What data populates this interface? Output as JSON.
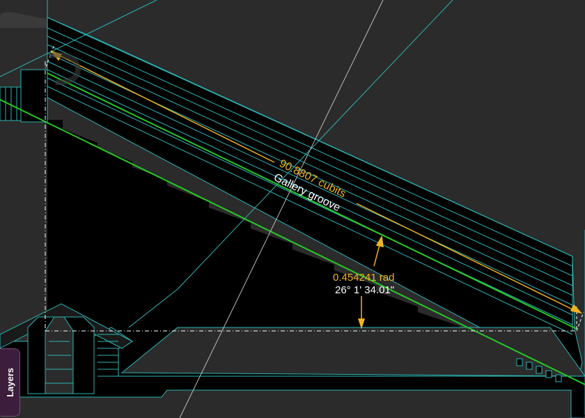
{
  "colors": {
    "background": "#2b2b2b",
    "structure_fill": "#000000",
    "outline": "#2fb5b5",
    "gallery_line": "#26c926",
    "measurement": "#f0b41e",
    "axis_line": "#bdbdbd",
    "text_white": "#ffffff"
  },
  "measurements": {
    "length_label": "90.8807 cubits",
    "angle_rad_label": "0.454241 rad",
    "angle_dms_label": "26° 1' 34.01\""
  },
  "annotations": {
    "gallery_label": "Gallery groove"
  },
  "panel": {
    "layers_tab_label": "Layers"
  }
}
